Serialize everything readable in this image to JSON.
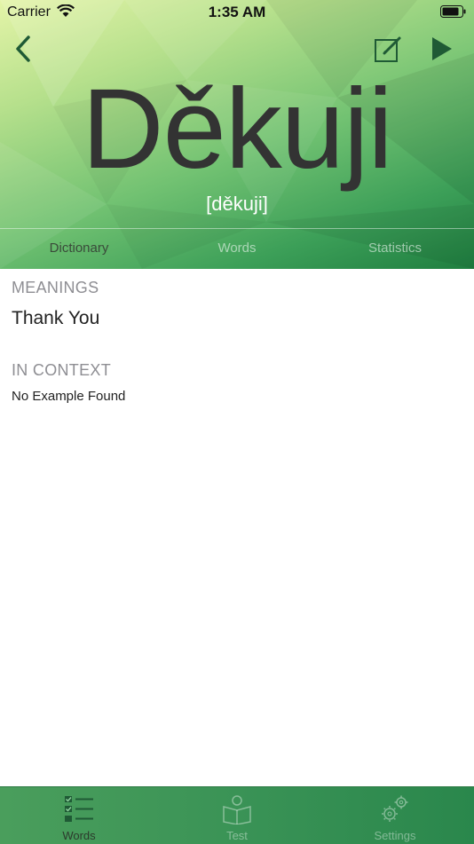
{
  "status_bar": {
    "carrier": "Carrier",
    "time": "1:35 AM"
  },
  "header": {
    "word": "Děkuji",
    "pronunciation": "[děkuji]",
    "back_icon": "chevron-left-icon",
    "edit_icon": "edit-note-icon",
    "play_icon": "play-icon"
  },
  "tabs": [
    {
      "label": "Dictionary",
      "active": true
    },
    {
      "label": "Words",
      "active": false
    },
    {
      "label": "Statistics",
      "active": false
    }
  ],
  "meanings": {
    "title": "MEANINGS",
    "items": [
      "Thank You"
    ]
  },
  "in_context": {
    "title": "IN CONTEXT",
    "text": "No Example Found"
  },
  "tab_bar": [
    {
      "label": "Words",
      "icon": "checklist-icon",
      "active": true
    },
    {
      "label": "Test",
      "icon": "book-reader-icon",
      "active": false
    },
    {
      "label": "Settings",
      "icon": "gears-icon",
      "active": false
    }
  ],
  "colors": {
    "header_gradient_start": "#e4f4a8",
    "header_gradient_end": "#1f7e40",
    "tab_bar": "#3a9356",
    "icon_dark": "#1f5a35"
  }
}
